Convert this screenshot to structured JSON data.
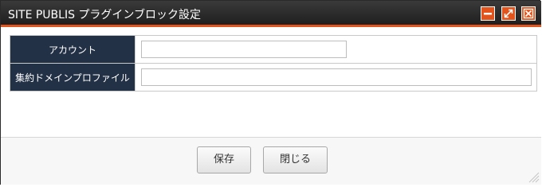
{
  "dialog": {
    "title": "SITE PUBLIS プラグインブロック設定",
    "window_buttons": {
      "minimize_icon": "minimize-icon",
      "maximize_icon": "maximize-icon",
      "close_icon": "close-icon"
    }
  },
  "form": {
    "rows": [
      {
        "label": "アカウント",
        "value": "",
        "placeholder": ""
      },
      {
        "label": "集約ドメインプロファイル",
        "value": "",
        "placeholder": ""
      }
    ]
  },
  "footer": {
    "save_label": "保存",
    "close_label": "閉じる"
  },
  "colors": {
    "accent": "#e2541b",
    "titlebar": "#262626",
    "label_bg": "#233146"
  }
}
